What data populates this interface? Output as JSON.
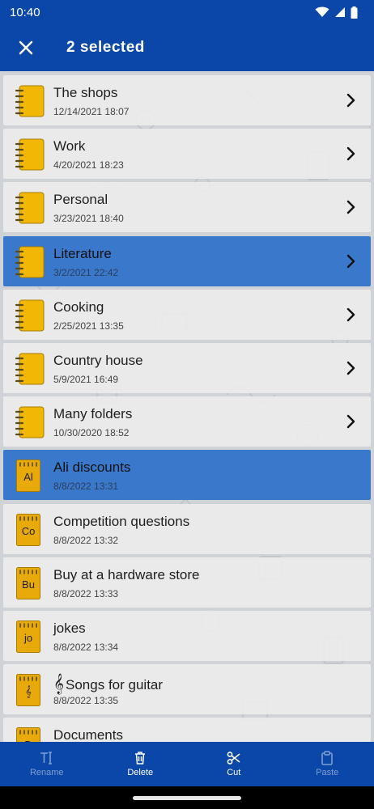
{
  "status": {
    "time": "10:40"
  },
  "appbar": {
    "title": "2 selected"
  },
  "items": [
    {
      "title": "The shops",
      "date": "12/14/2021 18:07",
      "type": "folder",
      "selected": false
    },
    {
      "title": "Work",
      "date": "4/20/2021 18:23",
      "type": "folder",
      "selected": false
    },
    {
      "title": "Personal",
      "date": "3/23/2021 18:40",
      "type": "folder",
      "selected": false
    },
    {
      "title": "Literature",
      "date": "3/2/2021 22:42",
      "type": "folder",
      "selected": true
    },
    {
      "title": "Cooking",
      "date": "2/25/2021 13:35",
      "type": "folder",
      "selected": false
    },
    {
      "title": "Country house",
      "date": "5/9/2021 16:49",
      "type": "folder",
      "selected": false
    },
    {
      "title": "Many folders",
      "date": "10/30/2020 18:52",
      "type": "folder",
      "selected": false
    },
    {
      "title": "Ali discounts",
      "date": "8/8/2022 13:31",
      "type": "note",
      "badge": "Al",
      "selected": true
    },
    {
      "title": "Competition questions",
      "date": "8/8/2022 13:32",
      "type": "note",
      "badge": "Co",
      "selected": false
    },
    {
      "title": "Buy at a hardware store",
      "date": "8/8/2022 13:33",
      "type": "note",
      "badge": "Bu",
      "selected": false
    },
    {
      "title": "jokes",
      "date": "8/8/2022 13:34",
      "type": "note",
      "badge": "jo",
      "selected": false
    },
    {
      "title": "Songs for guitar",
      "date": "8/8/2022 13:35",
      "type": "note",
      "badge": "𝄞",
      "clef": "𝄞",
      "selected": false
    },
    {
      "title": "Documents",
      "date": "",
      "type": "note",
      "badge": "D",
      "selected": false
    }
  ],
  "actions": [
    {
      "label": "Rename",
      "icon": "rename-icon",
      "enabled": false
    },
    {
      "label": "Delete",
      "icon": "trash-icon",
      "enabled": true
    },
    {
      "label": "Cut",
      "icon": "scissors-icon",
      "enabled": true
    },
    {
      "label": "Paste",
      "icon": "clipboard-icon",
      "enabled": false
    }
  ],
  "colors": {
    "primary": "#0b47a8",
    "selected": "#3a78cc",
    "folder": "#f2b705"
  }
}
